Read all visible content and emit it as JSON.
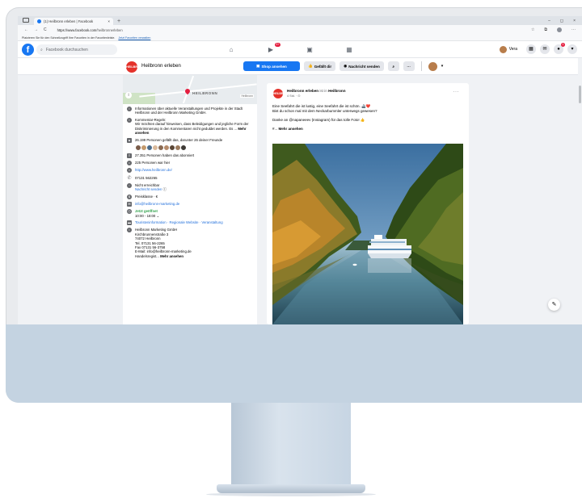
{
  "browser": {
    "tab_title": "(1) Heilbronn erleben | Facebook",
    "tab_close": "×",
    "new_tab": "+",
    "win_min": "–",
    "win_max": "◻",
    "win_close": "×",
    "back": "←",
    "forward": "→",
    "reload": "C",
    "url_domain": "https://www.facebook.com",
    "url_path": "/heilbronnerleben",
    "fav_hint": "Platzieren Sie für den Schnellzugriff Ihre Favoriten in der Favoritenleiste.",
    "fav_link": "Jetzt Favoriten verwalten"
  },
  "fb_nav": {
    "logo": "f",
    "search_placeholder": "Facebook durchsuchen",
    "home_icon": "⌂",
    "watch_icon": "▶",
    "watch_badge": "9+",
    "market_icon": "▣",
    "groups_icon": "▦",
    "user_name": "Vera",
    "menu_icon": "▦",
    "messenger_icon": "✉",
    "notif_icon": "●",
    "notif_badge": "1",
    "account_icon": "▾"
  },
  "page_bar": {
    "logo_text": "HEILBRONN",
    "name": "Heilbronn erleben",
    "shop_button": "Shop ansehen",
    "like_button": "Gefällt dir",
    "message_button": "Nachricht senden",
    "search_icon": "⌕",
    "more_icon": "···",
    "account_chevron": "▾"
  },
  "map": {
    "label": "HEILBRONN",
    "tag": "Heilbronn"
  },
  "info": {
    "about": "Informationen über aktuelle Veranstaltungen und Projekte in der Stadt Heilbronn und der Heilbronn Marketing GmbH.",
    "rules_title": "Kommentar-Regeln:",
    "rules_text": "Wir möchten darauf hinweisen, dass Beleidigungen und jegliche Form der Diskriminierung in den Kommentaren nicht geduldet werden. Es ...",
    "rules_more": "Mehr ansehen",
    "likes": "26.199 Personen gefällt das, darunter 26 deiner Freunde",
    "followers": "27.351 Personen haben das abonniert",
    "checkins": "225 Personen war hier",
    "website": "http://www.heilbronn.de/",
    "phone": "07131 562265",
    "unavailable": "Nicht erreichbar",
    "send_message": "Nachricht senden",
    "price": "Preisklasse · €",
    "email": "info@heilbronn-marketing.de",
    "open_now": "Jetzt geöffnet",
    "hours": "10:00 - 18:00",
    "categories": "Touristeninformation · Regionale Website · Veranstaltung",
    "impressum": [
      "Heilbronn Marketing GmbH",
      "Kirchbrunnenstraße 3",
      "74072 Heilbronn",
      "Tel. 07131 56-2265",
      "Fax 07131 56-3758",
      "E-Mail: info@heilbronn-marketing.de"
    ],
    "register": "Handelsregist...",
    "register_more": "Mehr ansehen"
  },
  "post": {
    "logo_text": "HEILBRONN",
    "author": "Heilbronn erleben",
    "author_in": "ist in",
    "place": "Heilbronn",
    "time": "4 Std. · ⊙",
    "more": "···",
    "line1": "Eine Seefahrt die ist lustig, eine Seefahrt die ist schön. 🚢❤️",
    "line2": "Bist du schon mal mit dem Neckarbummler unterwegs gewesen?",
    "line3": "Danke an @napaneeev (Instagram) für das tolle Foto! 👍",
    "line4_prefix": "#...",
    "line4_more": "Mehr ansehen"
  },
  "compose_icon": "✎"
}
